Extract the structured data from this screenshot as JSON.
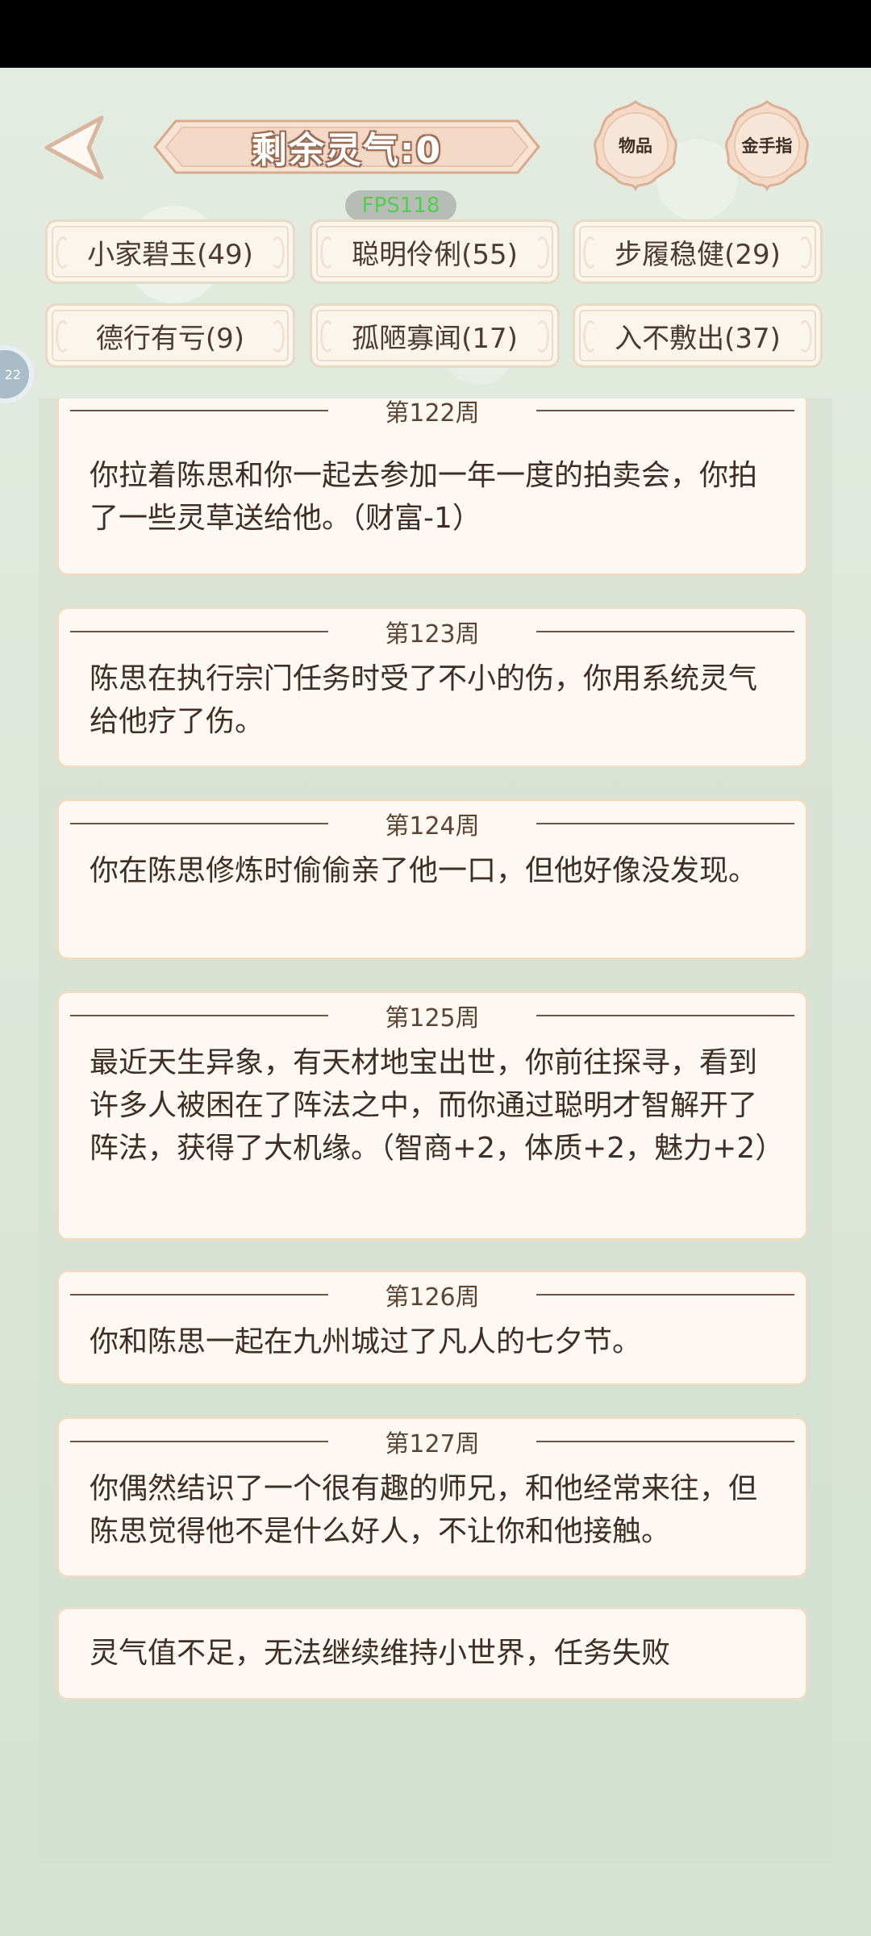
{
  "header": {
    "title": "剩余灵气:0",
    "items_button": "物品",
    "cheat_button": "金手指",
    "fps": "FPS118"
  },
  "side_float": {
    "label": "22"
  },
  "traits": [
    {
      "label": "小家碧玉(49)"
    },
    {
      "label": "聪明伶俐(55)"
    },
    {
      "label": "步履稳健(29)"
    },
    {
      "label": "德行有亏(9)"
    },
    {
      "label": "孤陋寡闻(17)"
    },
    {
      "label": "入不敷出(37)"
    }
  ],
  "events": [
    {
      "week": "第122周",
      "text": "你拉着陈思和你一起去参加一年一度的拍卖会，你拍了一些灵草送给他。（财富-1）"
    },
    {
      "week": "第123周",
      "text": "陈思在执行宗门任务时受了不小的伤，你用系统灵气给他疗了伤。"
    },
    {
      "week": "第124周",
      "text": "你在陈思修炼时偷偷亲了他一口，但他好像没发现。"
    },
    {
      "week": "第125周",
      "text": "最近天生异象，有天材地宝出世，你前往探寻，看到许多人被困在了阵法之中，而你通过聪明才智解开了阵法，获得了大机缘。（智商+2，体质+2，魅力+2）"
    },
    {
      "week": "第126周",
      "text": "你和陈思一起在九州城过了凡人的七夕节。"
    },
    {
      "week": "第127周",
      "text": "你偶然结识了一个很有趣的师兄，和他经常来往，但陈思觉得他不是什么好人，不让你和他接触。"
    }
  ],
  "final_message": "灵气值不足，无法继续维持小世界，任务失败"
}
